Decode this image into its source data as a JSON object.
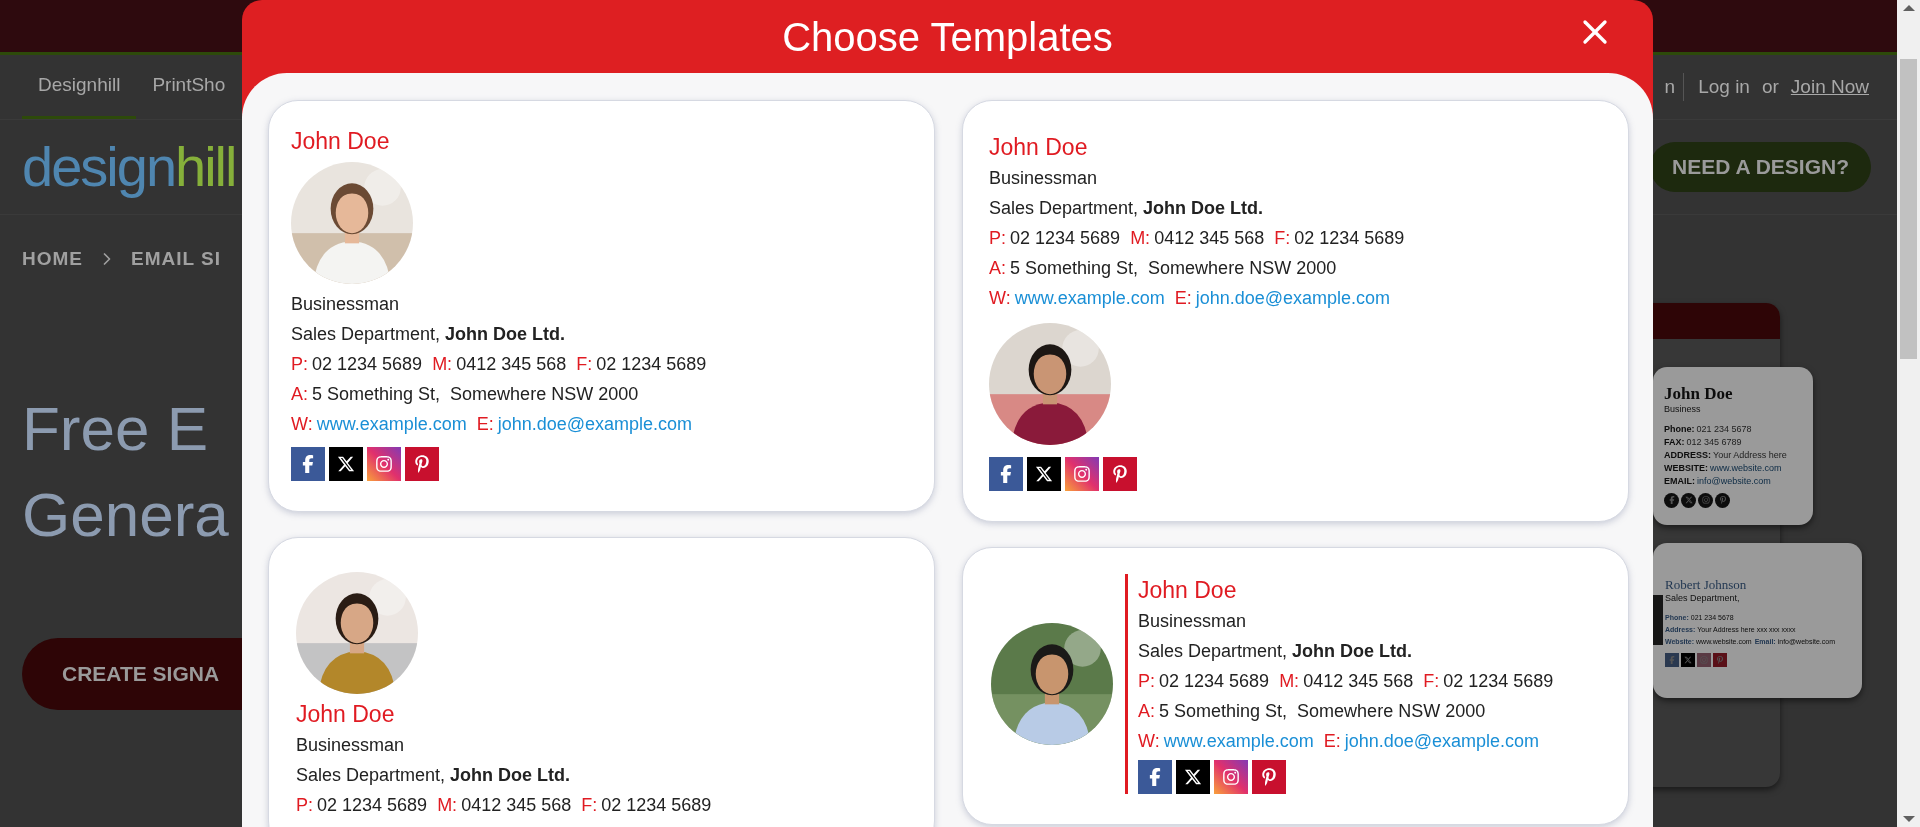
{
  "site": {
    "nav_tabs": [
      {
        "label": "Designhill",
        "selected": true
      },
      {
        "label": "PrintSho",
        "selected": false
      }
    ],
    "nav_right": {
      "cut_link": "n",
      "login": "Log in",
      "or": "or",
      "join": "Join Now"
    },
    "logo": {
      "part_1": "design",
      "part_2": "hill"
    },
    "need_design_button": "NEED A DESIGN?",
    "breadcrumb": [
      "HOME",
      "EMAIL SI"
    ],
    "hero_lines": [
      "Free E",
      "Genera"
    ],
    "create_button": "CREATE SIGNA",
    "preview_cards": [
      {
        "kind": "stacked",
        "name": "John Doe",
        "role": "Business",
        "rows": [
          [
            {
              "label": "Phone:",
              "value": "021 234 5678",
              "kind": "text"
            }
          ],
          [
            {
              "label": "FAX:",
              "value": "012 345 6789",
              "kind": "text"
            }
          ],
          [
            {
              "label": "ADDRESS:",
              "value": "Your Address here",
              "kind": "text"
            }
          ],
          [
            {
              "label": "WEBSITE:",
              "value": "www.website.com",
              "kind": "link"
            }
          ],
          [
            {
              "label": "EMAIL:",
              "value": "info@website.com",
              "kind": "link"
            }
          ]
        ],
        "socials": [
          {
            "kind": "facebook"
          },
          {
            "kind": "x"
          },
          {
            "kind": "instagram"
          },
          {
            "kind": "pinterest"
          }
        ]
      },
      {
        "kind": "compact",
        "name": "Robert Johnson",
        "role": "Sales Department,",
        "rows": [
          [
            {
              "label": "Phone:",
              "value": "021 234 5678",
              "kind": "text"
            }
          ],
          [
            {
              "label": "Address:",
              "value": "Your Address here xxx xxx xxxx",
              "kind": "text"
            }
          ],
          [
            {
              "label": "Website:",
              "value": "www.website.com",
              "kind": "text"
            },
            {
              "label": "Email:",
              "value": "info@website.com",
              "kind": "text"
            }
          ]
        ],
        "socials": [
          {
            "kind": "facebook"
          },
          {
            "kind": "x"
          },
          {
            "kind": "instagram"
          },
          {
            "kind": "pinterest"
          }
        ]
      }
    ]
  },
  "modal": {
    "title": "Choose Templates",
    "columns": [
      [
        {
          "kind": "photo-top",
          "name": "John Doe",
          "role": "Businessman",
          "department": "Sales Department, **John Doe Ltd.**",
          "rows": [
            [
              {
                "label": "P:",
                "value": "02 1234 5689",
                "kind": "text"
              },
              {
                "label": "M:",
                "value": "0412 345 568",
                "kind": "text"
              },
              {
                "label": "F:",
                "value": "02 1234 5689",
                "kind": "text"
              }
            ],
            [
              {
                "label": "A:",
                "value": "5 Something St,  Somewhere NSW 2000",
                "kind": "text"
              }
            ],
            [
              {
                "label": "W:",
                "value": "www.example.com",
                "kind": "link"
              },
              {
                "label": "E:",
                "value": "john.doe@example.com",
                "kind": "link"
              }
            ]
          ],
          "socials": [
            {
              "kind": "facebook"
            },
            {
              "kind": "x"
            },
            {
              "kind": "instagram"
            },
            {
              "kind": "pinterest"
            }
          ]
        },
        {
          "kind": "photo-first",
          "name": "John Doe",
          "role": "Businessman",
          "department": "Sales Department, **John Doe Ltd.**",
          "rows": [
            [
              {
                "label": "P:",
                "value": "02 1234 5689",
                "kind": "text"
              },
              {
                "label": "M:",
                "value": "0412 345 568",
                "kind": "text"
              },
              {
                "label": "F:",
                "value": "02 1234 5689",
                "kind": "text"
              }
            ]
          ]
        }
      ],
      [
        {
          "kind": "photo-bottom",
          "name": "John Doe",
          "role": "Businessman",
          "department": "Sales Department, **John Doe Ltd.**",
          "rows": [
            [
              {
                "label": "P:",
                "value": "02 1234 5689",
                "kind": "text"
              },
              {
                "label": "M:",
                "value": "0412 345 568",
                "kind": "text"
              },
              {
                "label": "F:",
                "value": "02 1234 5689",
                "kind": "text"
              }
            ],
            [
              {
                "label": "A:",
                "value": "5 Something St,  Somewhere NSW 2000",
                "kind": "text"
              }
            ],
            [
              {
                "label": "W:",
                "value": "www.example.com",
                "kind": "link"
              },
              {
                "label": "E:",
                "value": "john.doe@example.com",
                "kind": "link"
              }
            ]
          ],
          "socials": [
            {
              "kind": "facebook"
            },
            {
              "kind": "x"
            },
            {
              "kind": "instagram"
            },
            {
              "kind": "pinterest"
            }
          ]
        },
        {
          "kind": "photo-side",
          "name": "John Doe",
          "role": "Businessman",
          "department": "Sales Department, **John Doe Ltd.**",
          "rows": [
            [
              {
                "label": "P:",
                "value": "02 1234 5689",
                "kind": "text"
              },
              {
                "label": "M:",
                "value": "0412 345 568",
                "kind": "text"
              },
              {
                "label": "F:",
                "value": "02 1234 5689",
                "kind": "text"
              }
            ],
            [
              {
                "label": "A:",
                "value": "5 Something St,  Somewhere NSW 2000",
                "kind": "text"
              }
            ],
            [
              {
                "label": "W:",
                "value": "www.example.com",
                "kind": "link"
              },
              {
                "label": "E:",
                "value": "john.doe@example.com",
                "kind": "link"
              }
            ]
          ],
          "socials": [
            {
              "kind": "facebook"
            },
            {
              "kind": "x"
            },
            {
              "kind": "instagram"
            },
            {
              "kind": "pinterest"
            }
          ]
        }
      ]
    ]
  }
}
